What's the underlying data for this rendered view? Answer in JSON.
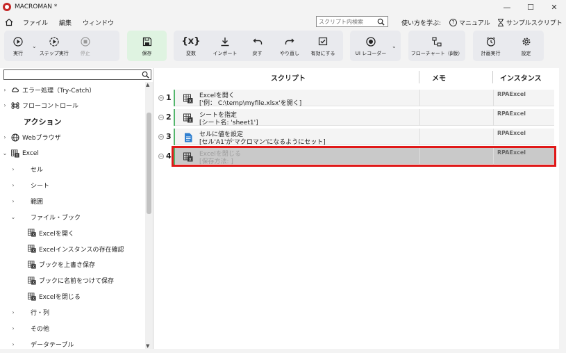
{
  "window": {
    "title": "MACROMAN *",
    "controls": {
      "minimize": "—",
      "maximize": "☐",
      "close": "✕"
    }
  },
  "menu": {
    "items": [
      "ファイル",
      "編集",
      "ウィンドウ"
    ],
    "search_placeholder": "スクリプト内検索",
    "learn_label": "使い方を学ぶ:",
    "manual_label": "マニュアル",
    "sample_label": "サンプルスクリプト"
  },
  "ribbon": {
    "run": "実行",
    "step_run": "ステップ実行",
    "stop": "停止",
    "save": "保存",
    "variable": "変数",
    "import": "インポート",
    "undo": "戻す",
    "redo": "やり直し",
    "enable": "有効にする",
    "ui_recorder": "UI レコーダー",
    "flowchart": "フローチャート（β版）",
    "schedule": "計画実行",
    "settings": "設定",
    "variable_icon": "{x}"
  },
  "tree": {
    "items": [
      {
        "label": "エラー処理（Try-Catch）",
        "level": 0,
        "chevron": "›",
        "icon": "cloud-icon"
      },
      {
        "label": "フローコントロール",
        "level": 0,
        "chevron": "›",
        "icon": "command-icon"
      },
      {
        "label": "アクション",
        "level": 0,
        "chevron": "",
        "icon": ""
      },
      {
        "label": "Webブラウザ",
        "level": 0,
        "chevron": "›",
        "icon": "globe-icon"
      },
      {
        "label": "Excel",
        "level": 0,
        "chevron": "⌄",
        "icon": "excel-icon"
      },
      {
        "label": "セル",
        "level": 1,
        "chevron": "›",
        "icon": ""
      },
      {
        "label": "シート",
        "level": 1,
        "chevron": "›",
        "icon": ""
      },
      {
        "label": "範囲",
        "level": 1,
        "chevron": "›",
        "icon": ""
      },
      {
        "label": "ファイル・ブック",
        "level": 1,
        "chevron": "⌄",
        "icon": ""
      },
      {
        "label": "Excelを開く",
        "level": 2,
        "chevron": "",
        "icon": "excel-icon"
      },
      {
        "label": "Excelインスタンスの存在確認",
        "level": 2,
        "chevron": "",
        "icon": "excel-icon"
      },
      {
        "label": "ブックを上書き保存",
        "level": 2,
        "chevron": "",
        "icon": "excel-icon"
      },
      {
        "label": "ブックに名前をつけて保存",
        "level": 2,
        "chevron": "",
        "icon": "excel-icon"
      },
      {
        "label": "Excelを閉じる",
        "level": 2,
        "chevron": "",
        "icon": "excel-icon"
      },
      {
        "label": "行・列",
        "level": 1,
        "chevron": "›",
        "icon": ""
      },
      {
        "label": "その他",
        "level": 1,
        "chevron": "›",
        "icon": ""
      },
      {
        "label": "データテーブル",
        "level": 1,
        "chevron": "›",
        "icon": ""
      }
    ]
  },
  "script": {
    "columns": {
      "script": "スクリプト",
      "memo": "メモ",
      "instance": "インスタンス"
    },
    "rows": [
      {
        "num": "1",
        "title": "Excelを開く",
        "detail": "['例： C:\\temp\\myfile.xlsx'を開く]",
        "instance": "RPAExcel",
        "icon": "excel-icon"
      },
      {
        "num": "2",
        "title": "シートを指定",
        "detail": "[シート名: 'sheet1']",
        "instance": "RPAExcel",
        "icon": "excel-icon"
      },
      {
        "num": "3",
        "title": "セルに値を設定",
        "detail": "[セル'A1'が'マクロマン'になるようにセット]",
        "instance": "RPAExcel",
        "icon": "document-icon"
      },
      {
        "num": "4",
        "title": "Excelを閉じる",
        "detail": "[保存方法: ]",
        "instance": "RPAExcel",
        "icon": "excel-icon",
        "selected": true
      }
    ]
  },
  "colors": {
    "accent_green": "#53b66c",
    "selection_red": "#e01818",
    "save_group": "#dff3e1"
  }
}
